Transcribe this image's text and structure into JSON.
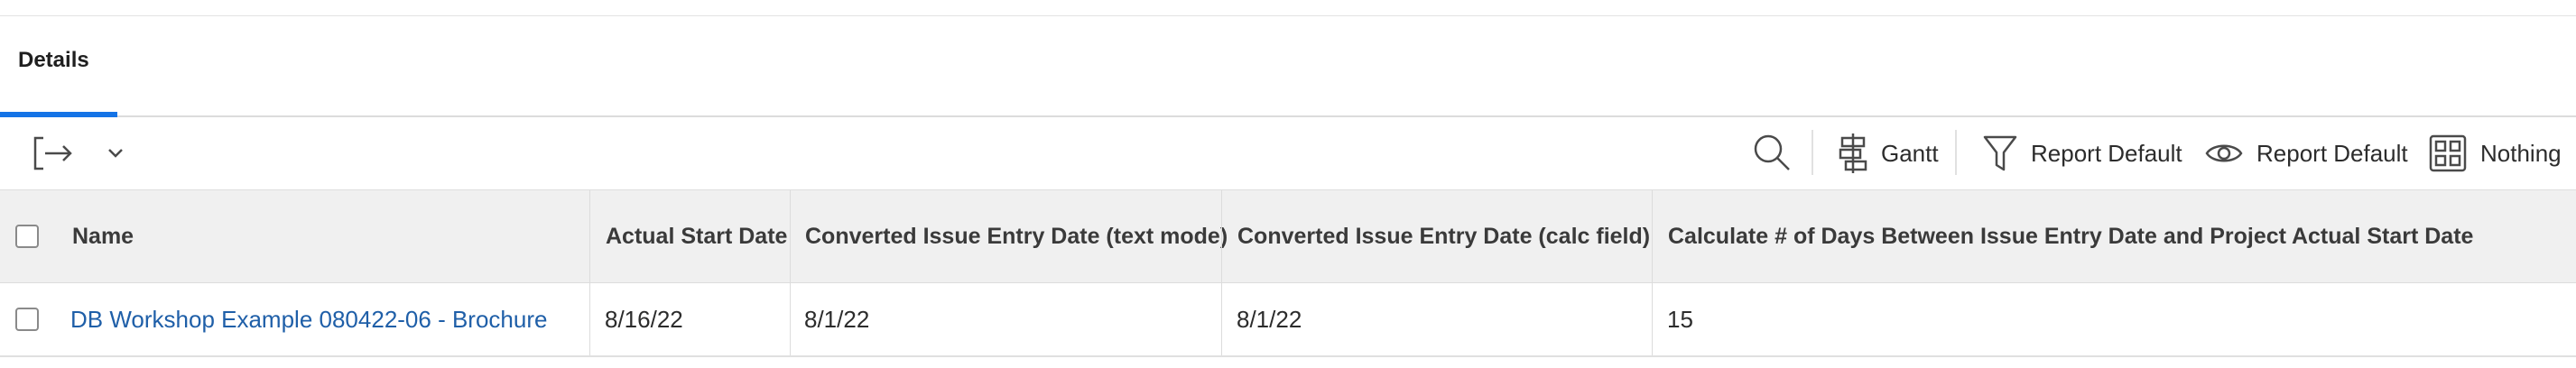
{
  "tabs": [
    {
      "label": "Details",
      "active": true
    }
  ],
  "toolbar": {
    "export_icon": "export-arrow-icon",
    "dropdown_icon": "chevron-down-icon",
    "search_icon": "search-icon",
    "gantt_label": "Gantt",
    "filter_label": "Report Default",
    "view_label": "Report Default",
    "grouping_label": "Nothing"
  },
  "table": {
    "columns": [
      "Name",
      "Actual Start Date",
      "Converted Issue Entry Date (text mode)",
      "Converted Issue Entry Date (calc field)",
      "Calculate # of Days Between Issue Entry Date and Project Actual Start Date"
    ],
    "rows": [
      {
        "name": "DB Workshop Example 080422-06 - Brochure",
        "actual_start_date": "8/16/22",
        "converted_text_mode": "8/1/22",
        "converted_calc_field": "8/1/22",
        "days_between": "15"
      }
    ]
  },
  "colors": {
    "accent": "#1473e6",
    "link": "#1f5fa8",
    "header_bg": "#f0f0f0"
  }
}
